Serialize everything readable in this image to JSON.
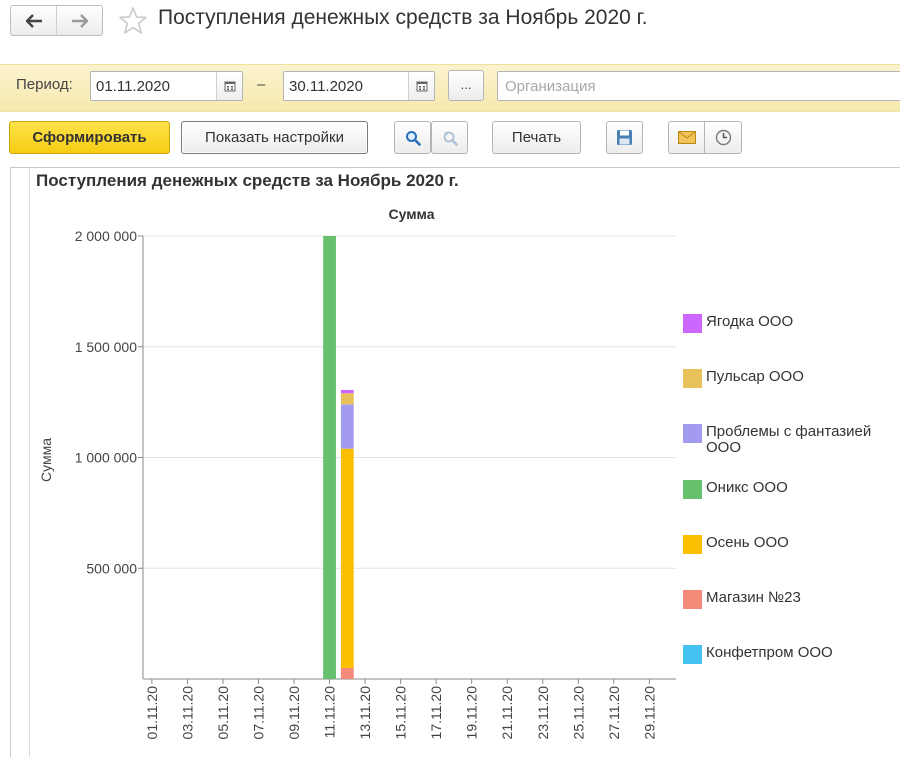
{
  "window": {
    "title": "Поступления денежных средств за Ноябрь 2020 г."
  },
  "params": {
    "period_label": "Период:",
    "date_from": "01.11.2020",
    "date_sep": "–",
    "date_to": "30.11.2020",
    "more_label": "...",
    "org_placeholder": "Организация"
  },
  "toolbar": {
    "generate_label": "Сформировать",
    "settings_label": "Показать настройки",
    "print_label": "Печать"
  },
  "report": {
    "title": "Поступления денежных средств за Ноябрь 2020 г."
  },
  "chart_data": {
    "type": "bar",
    "stacked": true,
    "title": "Сумма",
    "ylabel": "Сумма",
    "xlabel": "",
    "ylim": [
      0,
      2000000
    ],
    "y_ticks": [
      "2 000 000",
      "1 500 000",
      "1 000 000",
      "500 000"
    ],
    "y_tick_values": [
      2000000,
      1500000,
      1000000,
      500000
    ],
    "x_ticks": [
      "01.11.20",
      "03.11.20",
      "05.11.20",
      "07.11.20",
      "09.11.20",
      "11.11.20",
      "13.11.20",
      "15.11.20",
      "17.11.20",
      "19.11.20",
      "21.11.20",
      "23.11.20",
      "25.11.20",
      "27.11.20",
      "29.11.20"
    ],
    "legend_position": "right",
    "grid": true,
    "series": [
      {
        "name": "Ягодка ООО",
        "color": "#cc66ff",
        "values": {
          "12.11.20": 15000
        }
      },
      {
        "name": "Пульсар ООО",
        "color": "#e8c15a",
        "values": {
          "12.11.20": 50000
        }
      },
      {
        "name": "Проблемы с фантазией ООО",
        "color": "#a29bf0",
        "values": {
          "12.11.20": 200000
        }
      },
      {
        "name": "Оникс ООО",
        "color": "#66c06e",
        "values": {
          "11.11.20": 2000000
        }
      },
      {
        "name": "Осень ООО",
        "color": "#fbbf00",
        "values": {
          "12.11.20": 990000
        }
      },
      {
        "name": "Магазин №23",
        "color": "#f58a7a",
        "values": {
          "12.11.20": 50000
        }
      },
      {
        "name": "Конфетпром ООО",
        "color": "#44c3f0",
        "values": {}
      }
    ]
  },
  "colors": {
    "param_bar": "#f8ecb6",
    "primary_button": "#f8d425"
  },
  "icons": [
    "back-arrow-icon",
    "forward-arrow-icon",
    "star-icon",
    "calendar-icon",
    "search-icon",
    "search-refresh-icon",
    "save-icon",
    "mail-icon",
    "clock-icon"
  ]
}
